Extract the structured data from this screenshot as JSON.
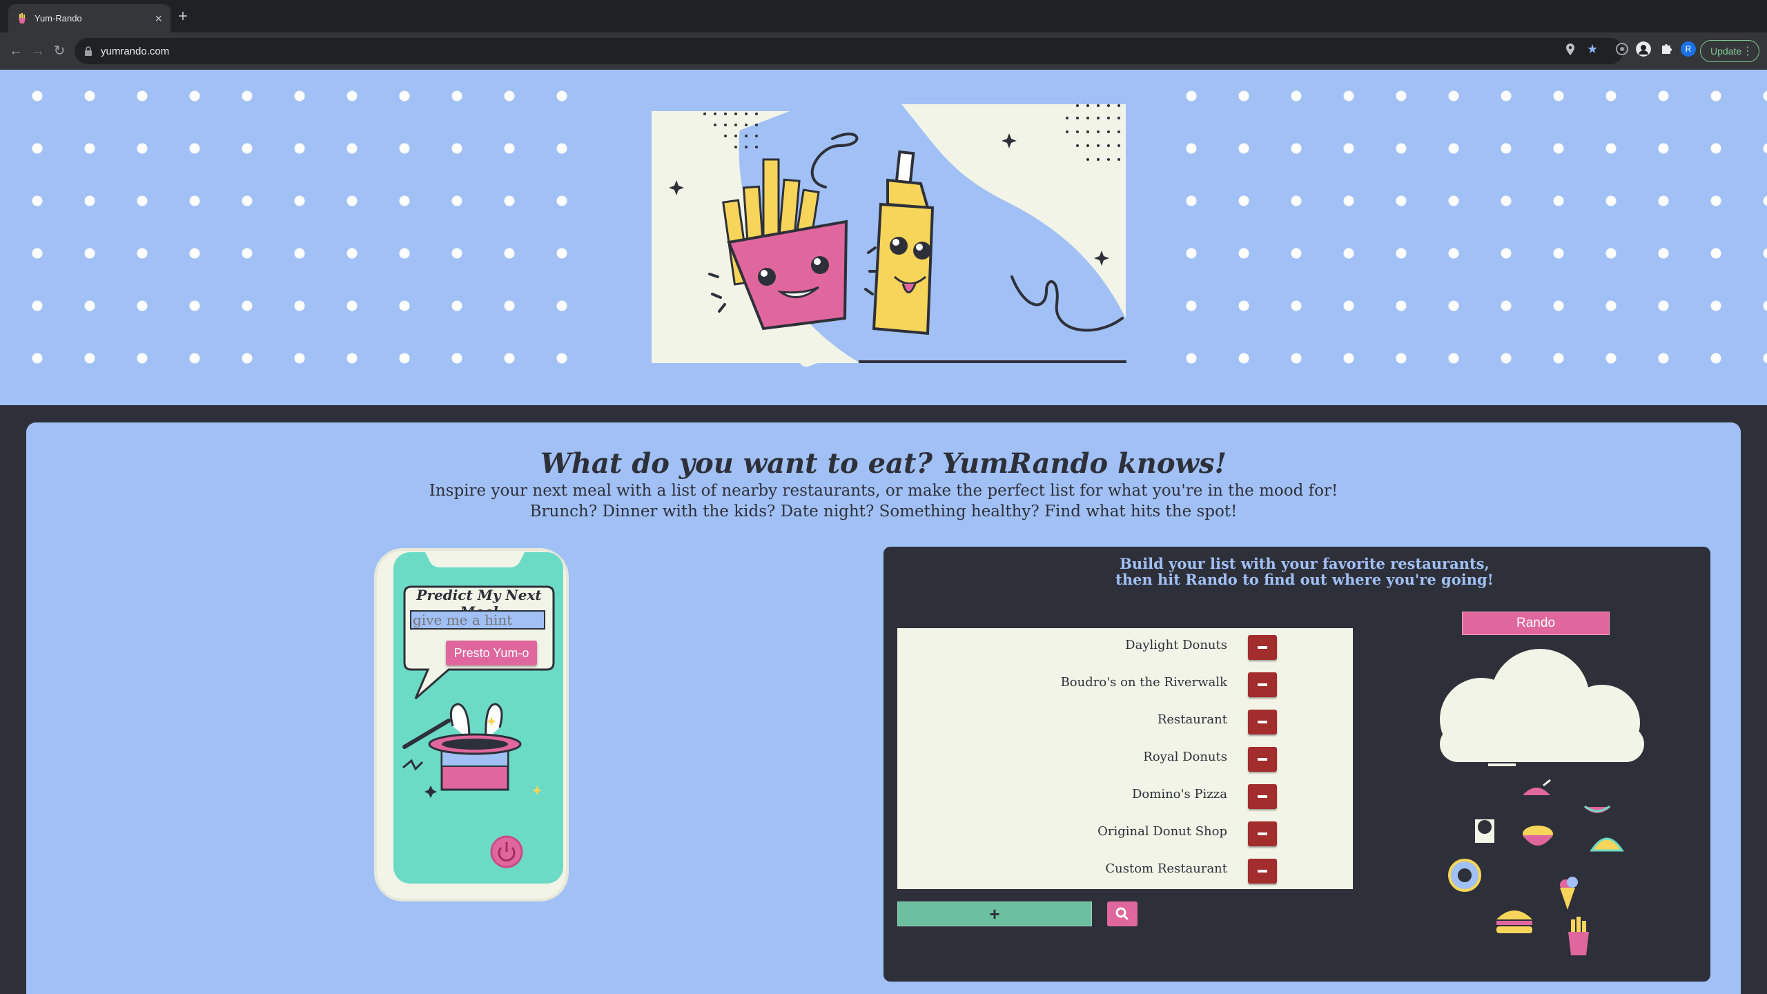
{
  "browser": {
    "tab_title": "Yum-Rando",
    "tab_close": "×",
    "new_tab": "+",
    "url": "yumrando.com",
    "update_label": "Update",
    "nav": {
      "back": "←",
      "forward": "→",
      "reload": "↻"
    },
    "omni_icons": {
      "location": "location-pin-icon",
      "bookmark": "★"
    },
    "profile_initial": "R"
  },
  "hero": {
    "illustration": "fries-and-mustard-illustration"
  },
  "main": {
    "headline": "What do you want to eat? YumRando knows!",
    "subline_1": "Inspire your next meal with a list of nearby restaurants, or make the perfect list for what you're in the mood for!",
    "subline_2": "Brunch? Dinner with the kids? Date night? Something healthy? Find what hits the spot!"
  },
  "predictor": {
    "title": "Predict My Next Meal",
    "placeholder": "give me a hint",
    "button_label": "Presto Yum-o"
  },
  "list_panel": {
    "instructions_1": "Build your list with your favorite restaurants,",
    "instructions_2": "then hit Rando to find out where you're going!",
    "restaurants": [
      "Daylight Donuts",
      "Boudro's on the Riverwalk",
      "Restaurant",
      "Royal Donuts",
      "Domino's Pizza",
      "Original Donut Shop",
      "Custom Restaurant"
    ],
    "add_label": "+",
    "rando_label": "Rando"
  },
  "colors": {
    "page_blue": "#a1c0f5",
    "dark": "#2e3039",
    "pink": "#e0679d",
    "teal": "#6cdbc6",
    "cream": "#f2f4e7",
    "remove_red": "#a32c2c",
    "yellow": "#f7d55a"
  }
}
